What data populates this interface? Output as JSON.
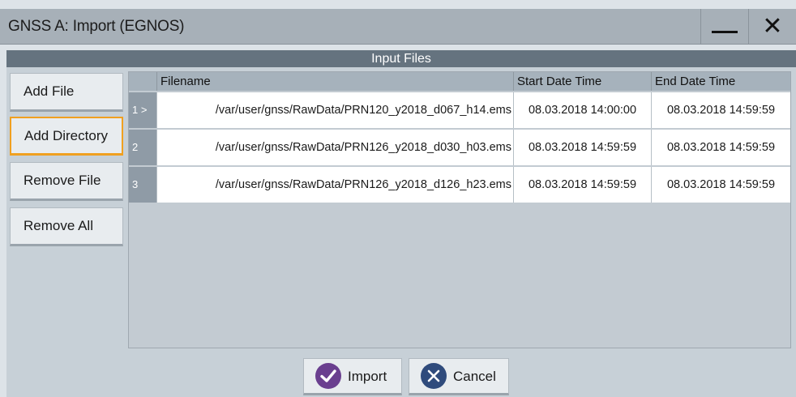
{
  "window": {
    "title": "GNSS A: Import (EGNOS)",
    "minimize_icon": "minimize-icon",
    "close_glyph": "✕"
  },
  "section": {
    "title": "Input Files"
  },
  "side_buttons": [
    {
      "label": "Add File"
    },
    {
      "label": "Add Directory"
    },
    {
      "label": "Remove File"
    },
    {
      "label": "Remove All"
    }
  ],
  "table": {
    "columns": [
      "Filename",
      "Start Date Time",
      "End Date Time"
    ],
    "rows": [
      {
        "index": "1 >",
        "filename": "/var/user/gnss/RawData/PRN120_y2018_d067_h14.ems",
        "start": "08.03.2018 14:00:00",
        "end": "08.03.2018 14:59:59"
      },
      {
        "index": "2",
        "filename": "/var/user/gnss/RawData/PRN126_y2018_d030_h03.ems",
        "start": "08.03.2018 14:59:59",
        "end": "08.03.2018 14:59:59"
      },
      {
        "index": "3",
        "filename": "/var/user/gnss/RawData/PRN126_y2018_d126_h23.ems",
        "start": "08.03.2018 14:59:59",
        "end": "08.03.2018 14:59:59"
      }
    ]
  },
  "actions": {
    "import_label": "Import",
    "cancel_label": "Cancel",
    "import_icon": "check-circle-icon",
    "cancel_icon": "x-circle-icon"
  },
  "colors": {
    "import_accent": "#6a3f8f",
    "cancel_accent": "#2f4b7c",
    "focus": "#f0a020"
  }
}
